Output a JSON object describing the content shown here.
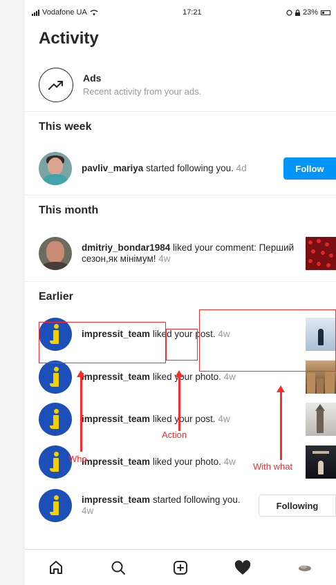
{
  "status_bar": {
    "carrier": "Vodafone UA",
    "time": "17:21",
    "battery": "23%"
  },
  "page": {
    "title": "Activity"
  },
  "ads": {
    "title": "Ads",
    "subtitle": "Recent activity from your ads."
  },
  "sections": {
    "this_week": "This week",
    "this_month": "This month",
    "earlier": "Earlier"
  },
  "this_week": {
    "user": "pavliv_mariya",
    "action": " started following you.",
    "time": " 4d",
    "button": "Follow"
  },
  "this_month": {
    "user": "dmitriy_bondar1984",
    "action": " liked your comment: Перший сезон,як мінімум!",
    "time": " 4w"
  },
  "earlier": [
    {
      "user": "impressit_team",
      "action": " liked your post.",
      "time": " 4w",
      "thumb": "snow"
    },
    {
      "user": "impressit_team",
      "action": " liked your photo.",
      "time": " 4w",
      "thumb": "city"
    },
    {
      "user": "impressit_team",
      "action": " liked your post.",
      "time": " 4w",
      "thumb": "church"
    },
    {
      "user": "impressit_team",
      "action": " liked your photo.",
      "time": " 4w",
      "thumb": "dark"
    },
    {
      "user": "impressit_team",
      "action": " started following you.",
      "time": " 4w",
      "button": "Following"
    }
  ],
  "annotations": {
    "who": "Who",
    "action": "Action",
    "with_what": "With what",
    "color": "#ff2a2a"
  },
  "tabs": [
    "home-icon",
    "search-icon",
    "add-post-icon",
    "heart-icon",
    "profile-icon"
  ],
  "colors": {
    "accent": "#0095f6",
    "impressit_blue": "#1d4fb8",
    "impressit_yellow": "#f5d000"
  }
}
